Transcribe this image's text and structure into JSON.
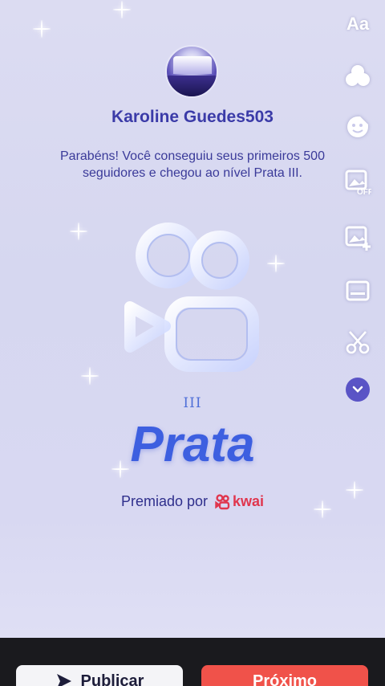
{
  "profile": {
    "username": "Karoline Guedes503"
  },
  "achievement": {
    "message": "Parabéns! Você conseguiu seus primeiros 500 seguidores e chegou ao nível Prata III.",
    "level_roman": "III",
    "level_name": "Prata",
    "awarded_by_label": "Premiado por",
    "brand_name": "kwai"
  },
  "side_tools": {
    "text_label": "Aa",
    "items": [
      "text-icon",
      "effects-icon",
      "sticker-icon",
      "image-off-icon",
      "add-image-icon",
      "caption-icon",
      "scissors-icon",
      "chevron-down-icon"
    ]
  },
  "bottom_bar": {
    "publish_label": "Publicar",
    "next_label": "Próximo"
  },
  "colors": {
    "title": "#3b3ba8",
    "level": "#3d5fe0",
    "brand": "#e0364e",
    "next_button": "#f0524a",
    "more_button": "#5a54c6"
  }
}
